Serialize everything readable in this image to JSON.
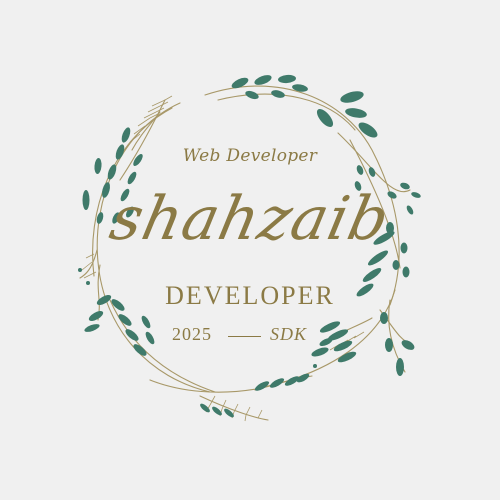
{
  "logo": {
    "subtitle": "Web Developer",
    "name": "shahzaib",
    "role": "DEVELOPER",
    "year": "2025",
    "code": "SDK"
  },
  "colors": {
    "background": "#f0f0f0",
    "text": "#8b7a45",
    "leaf": "#3f7a6a",
    "stem": "#a89868"
  }
}
